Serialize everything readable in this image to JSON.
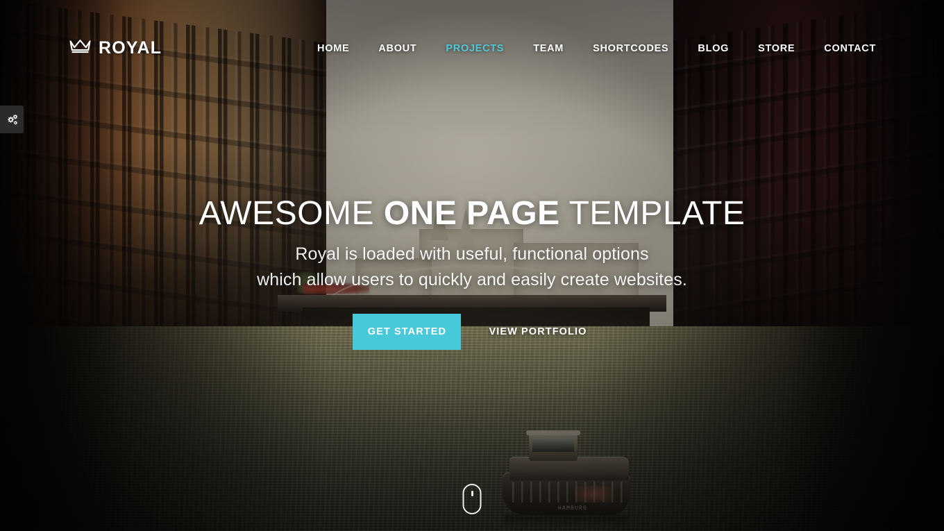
{
  "site": {
    "brand_name": "ROYAL",
    "brand_icon": "crown-icon",
    "accent_color": "#48c9da",
    "scene_description": "Hamburg Speicherstadt canal between brick warehouses"
  },
  "settings_tab": {
    "icon": "gears-icon",
    "background_color": "#2b2b2b"
  },
  "nav": {
    "items": [
      {
        "label": "HOME",
        "active": false
      },
      {
        "label": "ABOUT",
        "active": false
      },
      {
        "label": "PROJECTS",
        "active": true
      },
      {
        "label": "TEAM",
        "active": false
      },
      {
        "label": "SHORTCODES",
        "active": false
      },
      {
        "label": "BLOG",
        "active": false
      },
      {
        "label": "STORE",
        "active": false
      },
      {
        "label": "CONTACT",
        "active": false
      }
    ]
  },
  "hero": {
    "headline_part1": "AWESOME ",
    "headline_emphasis": "ONE PAGE",
    "headline_part2": " TEMPLATE",
    "subline_line1": "Royal is loaded with useful, functional options",
    "subline_line2": "which allow users to quickly and easily create websites.",
    "primary_button": "GET STARTED",
    "secondary_button": "VIEW PORTFOLIO"
  },
  "scroll": {
    "icon": "mouse-scroll-icon"
  },
  "scene": {
    "boat_name": "HAMBURG"
  }
}
